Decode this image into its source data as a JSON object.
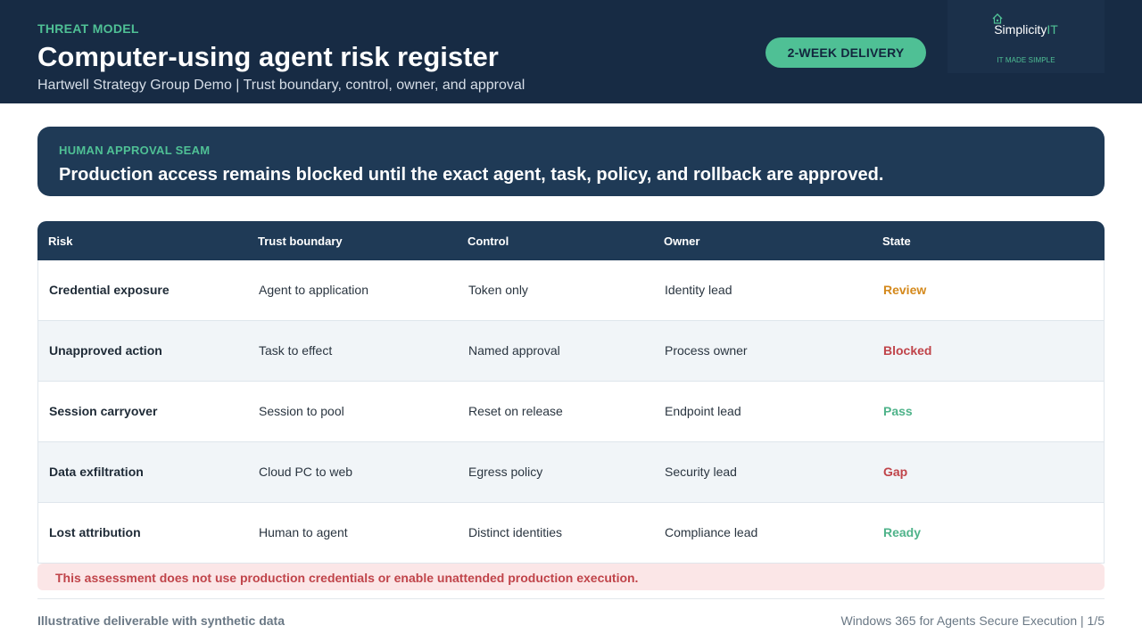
{
  "header": {
    "eyebrow": "THREAT MODEL",
    "title": "Computer-using agent risk register",
    "subtitle": "Hartwell Strategy Group Demo | Trust boundary, control, owner, and approval",
    "pill": "2-WEEK DELIVERY",
    "logo": {
      "name_main": "Simplicity",
      "name_accent": "IT",
      "tagline": "IT MADE SIMPLE",
      "icon": "cloud-house-icon"
    }
  },
  "banner": {
    "label": "HUMAN APPROVAL SEAM",
    "text": "Production access remains blocked until the exact agent, task, policy, and rollback are approved."
  },
  "table": {
    "columns": [
      "Risk",
      "Trust boundary",
      "Control",
      "Owner",
      "State"
    ],
    "rows": [
      {
        "risk": "Credential exposure",
        "boundary": "Agent to application",
        "control": "Token only",
        "owner": "Identity lead",
        "state": "Review"
      },
      {
        "risk": "Unapproved action",
        "boundary": "Task to effect",
        "control": "Named approval",
        "owner": "Process owner",
        "state": "Blocked"
      },
      {
        "risk": "Session carryover",
        "boundary": "Session to pool",
        "control": "Reset on release",
        "owner": "Endpoint lead",
        "state": "Pass"
      },
      {
        "risk": "Data exfiltration",
        "boundary": "Cloud PC to web",
        "control": "Egress policy",
        "owner": "Security lead",
        "state": "Gap"
      },
      {
        "risk": "Lost attribution",
        "boundary": "Human to agent",
        "control": "Distinct identities",
        "owner": "Compliance lead",
        "state": "Ready"
      }
    ]
  },
  "state_colors": {
    "Review": "#d4891c",
    "Blocked": "#c0444a",
    "Pass": "#4fb38a",
    "Gap": "#c0444a",
    "Ready": "#4fb38a"
  },
  "notice": "This assessment does not use production credentials or enable unattended production execution.",
  "footer": {
    "left": "Illustrative deliverable with synthetic data",
    "right": "Windows 365 for Agents Secure Execution | 1/5"
  }
}
